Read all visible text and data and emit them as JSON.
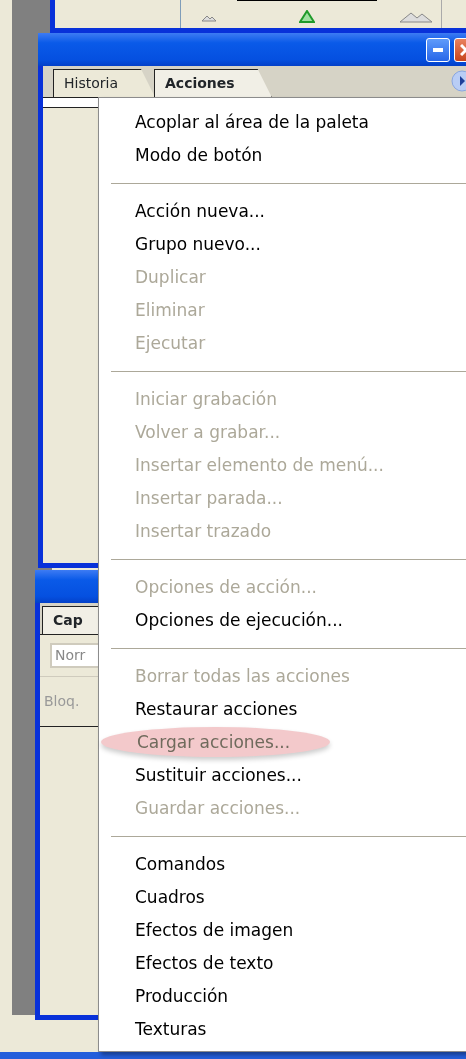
{
  "top_window": {
    "slider": {
      "level": 0.5
    }
  },
  "palette": {
    "tabs": [
      {
        "label": "Historia",
        "selected": false
      },
      {
        "label": "Acciones",
        "selected": true
      }
    ]
  },
  "layers_panel": {
    "tabs": [
      {
        "label": "Cap",
        "selected": true
      }
    ],
    "blend_mode": {
      "value": "Norr"
    },
    "lock_label": "Bloq."
  },
  "menu": {
    "groups": [
      [
        {
          "label": "Acoplar al área de la paleta",
          "disabled": false,
          "highlighted": false
        },
        {
          "label": "Modo de botón",
          "disabled": false,
          "highlighted": false
        }
      ],
      [
        {
          "label": "Acción nueva...",
          "disabled": false,
          "highlighted": false
        },
        {
          "label": "Grupo nuevo...",
          "disabled": false,
          "highlighted": false
        },
        {
          "label": "Duplicar",
          "disabled": true,
          "highlighted": false
        },
        {
          "label": "Eliminar",
          "disabled": true,
          "highlighted": false
        },
        {
          "label": "Ejecutar",
          "disabled": true,
          "highlighted": false
        }
      ],
      [
        {
          "label": "Iniciar grabación",
          "disabled": true,
          "highlighted": false
        },
        {
          "label": "Volver a grabar...",
          "disabled": true,
          "highlighted": false
        },
        {
          "label": "Insertar elemento de menú...",
          "disabled": true,
          "highlighted": false
        },
        {
          "label": "Insertar parada...",
          "disabled": true,
          "highlighted": false
        },
        {
          "label": "Insertar trazado",
          "disabled": true,
          "highlighted": false
        }
      ],
      [
        {
          "label": "Opciones de acción...",
          "disabled": true,
          "highlighted": false
        },
        {
          "label": "Opciones de ejecución...",
          "disabled": false,
          "highlighted": false
        }
      ],
      [
        {
          "label": "Borrar todas las acciones",
          "disabled": true,
          "highlighted": false
        },
        {
          "label": "Restaurar acciones",
          "disabled": false,
          "highlighted": false
        },
        {
          "label": "Cargar acciones...",
          "disabled": true,
          "highlighted": true
        },
        {
          "label": "Sustituir acciones...",
          "disabled": false,
          "highlighted": false
        },
        {
          "label": "Guardar acciones...",
          "disabled": true,
          "highlighted": false
        }
      ],
      [
        {
          "label": "Comandos",
          "disabled": false,
          "highlighted": false
        },
        {
          "label": "Cuadros",
          "disabled": false,
          "highlighted": false
        },
        {
          "label": "Efectos de imagen",
          "disabled": false,
          "highlighted": false
        },
        {
          "label": "Efectos de texto",
          "disabled": false,
          "highlighted": false
        },
        {
          "label": "Producción",
          "disabled": false,
          "highlighted": false
        },
        {
          "label": "Texturas",
          "disabled": false,
          "highlighted": false
        }
      ]
    ]
  }
}
